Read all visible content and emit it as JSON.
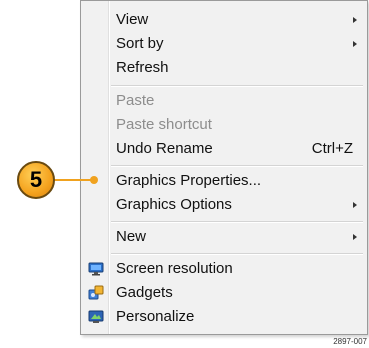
{
  "menu": {
    "items": [
      {
        "label": "View"
      },
      {
        "label": "Sort by"
      },
      {
        "label": "Refresh"
      },
      {
        "label": "Paste"
      },
      {
        "label": "Paste shortcut"
      },
      {
        "label": "Undo Rename",
        "shortcut": "Ctrl+Z"
      },
      {
        "label": "Graphics Properties..."
      },
      {
        "label": "Graphics Options"
      },
      {
        "label": "New"
      },
      {
        "label": "Screen resolution",
        "icon": "monitor-icon"
      },
      {
        "label": "Gadgets",
        "icon": "gadgets-icon"
      },
      {
        "label": "Personalize",
        "icon": "personalize-icon"
      }
    ]
  },
  "callout": {
    "number": "5",
    "color": "#f4a21e"
  },
  "figure_id": "2897-007"
}
